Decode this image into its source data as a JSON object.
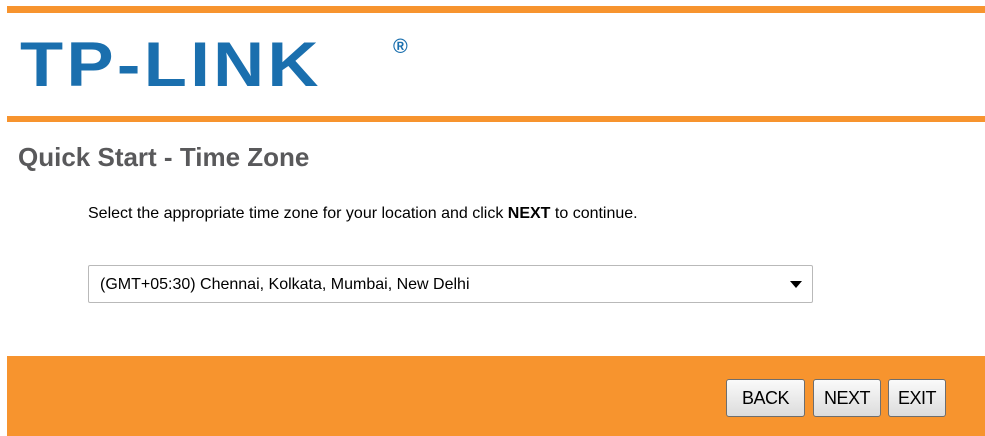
{
  "brand": {
    "logo_text": "TP-LINK",
    "registered_mark": "®",
    "logo_color": "#1a6fae",
    "accent_color": "#f7942e"
  },
  "page": {
    "title": "Quick Start - Time Zone",
    "instruction_prefix": "Select the appropriate time zone for your location and click ",
    "instruction_emphasis": "NEXT",
    "instruction_suffix": " to continue."
  },
  "timezone": {
    "selected": "(GMT+05:30) Chennai, Kolkata, Mumbai, New Delhi"
  },
  "buttons": {
    "back": "BACK",
    "next": "NEXT",
    "exit": "EXIT"
  }
}
